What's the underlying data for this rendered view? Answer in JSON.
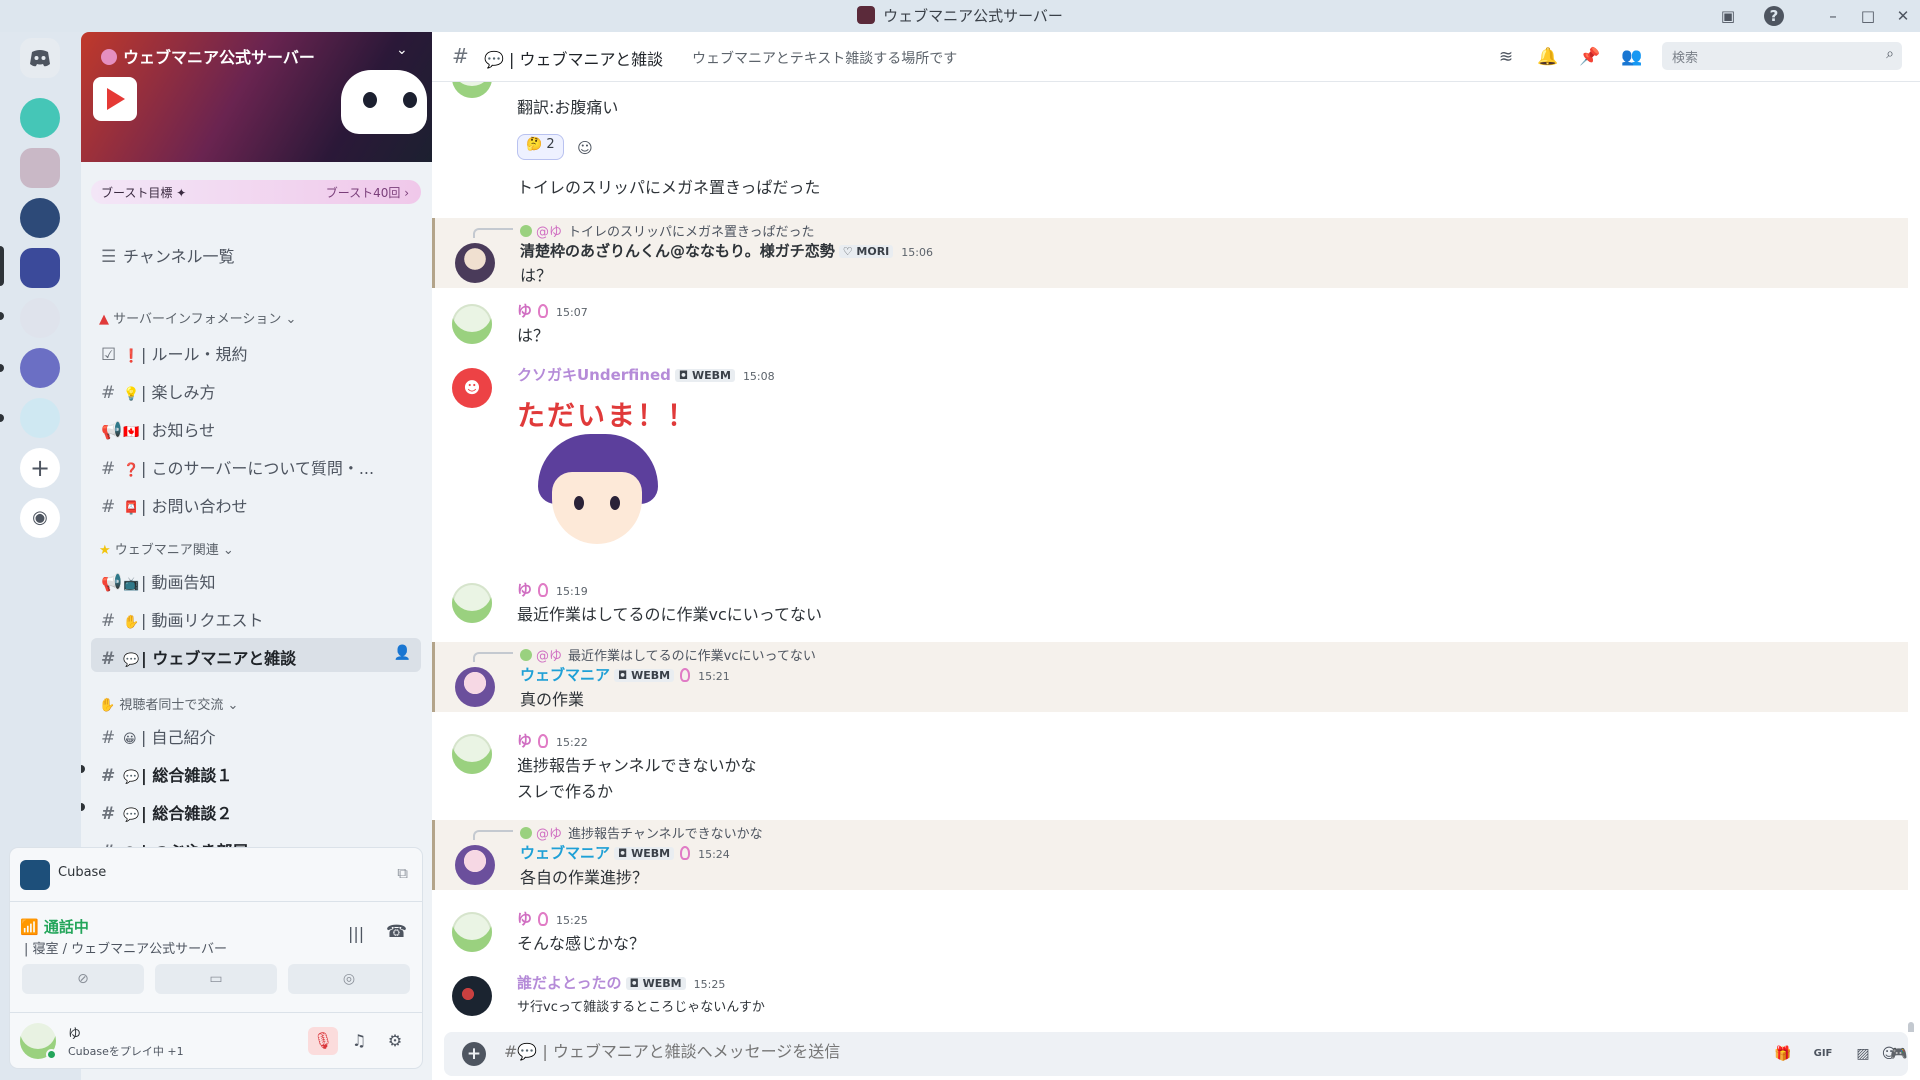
{
  "window": {
    "title": "ウェブマニア公式サーバー"
  },
  "server": {
    "name": "ウェブマニア公式サーバー",
    "boost_label": "ブースト目標",
    "boost_right": "ブースト40回 ›"
  },
  "sidebar": {
    "channel_list_label": "チャンネル一覧",
    "categories": [
      {
        "label": "サーバーインフォメーション ⌄"
      },
      {
        "label": "ウェブマニア関連 ⌄"
      },
      {
        "label": "視聴者同士で交流 ⌄"
      }
    ],
    "channels": [
      {
        "icon": "☑",
        "emo": "❗",
        "label": "| ルール・規約"
      },
      {
        "icon": "#",
        "emo": "💡",
        "label": "| 楽しみ方"
      },
      {
        "icon": "📢",
        "emo": "🇨🇦",
        "label": "| お知らせ"
      },
      {
        "icon": "#",
        "emo": "❓",
        "label": "| このサーバーについて質問・..."
      },
      {
        "icon": "#",
        "emo": "📮",
        "label": "| お問い合わせ"
      },
      {
        "icon": "📢",
        "emo": "📺",
        "label": "| 動画告知"
      },
      {
        "icon": "#",
        "emo": "✋",
        "label": "| 動画リクエスト"
      },
      {
        "icon": "#",
        "emo": "💬",
        "label": "| ウェブマニアと雑談"
      },
      {
        "icon": "#",
        "emo": "😀",
        "label": "| 自己紹介"
      },
      {
        "icon": "#",
        "emo": "💬",
        "label": "| 総合雑談１"
      },
      {
        "icon": "#",
        "emo": "💬",
        "label": "| 総合雑談２"
      },
      {
        "icon": "#",
        "emo": "😊",
        "label": "| つぶやき部屋"
      }
    ]
  },
  "activity": {
    "app": "Cubase"
  },
  "voice": {
    "status": "通話中",
    "location": "| 寝室 / ウェブマニア公式サーバー"
  },
  "user": {
    "name": "ゆ",
    "status": "Cubaseをプレイ中 +1"
  },
  "header": {
    "channel_name": "| ウェブマニアと雑談",
    "topic": "ウェブマニアとテキスト雑談する場所です",
    "search_placeholder": "検索"
  },
  "messages": [
    {
      "text": "翻訳:お腹痛い",
      "reaction_count": "2"
    },
    {
      "text": "トイレのスリッパにメガネ置きっぱだった"
    },
    {
      "reply_who": "@ゆ",
      "reply_text": "トイレのスリッパにメガネ置きっぱだった",
      "author": "清楚枠のあざりんくん@ななもり。様ガチ恋勢",
      "tag": "MORI",
      "time": "15:06",
      "text": "は？"
    },
    {
      "author": "ゆ",
      "time": "15:07",
      "text": "は？"
    },
    {
      "author": "クソガキUnderfined",
      "tag": "WEBM",
      "time": "15:08",
      "sticker_text": "ただいま！！"
    },
    {
      "author": "ゆ",
      "time": "15:19",
      "text": "最近作業はしてるのに作業vcにいってない"
    },
    {
      "reply_who": "@ゆ",
      "reply_text": "最近作業はしてるのに作業vcにいってない",
      "author": "ウェブマニア",
      "tag": "WEBM",
      "time": "15:21",
      "text": "真の作業"
    },
    {
      "author": "ゆ",
      "time": "15:22",
      "text": "進捗報告チャンネルできないかな",
      "text2": "スレで作るか"
    },
    {
      "reply_who": "@ゆ",
      "reply_text": "進捗報告チャンネルできないかな",
      "author": "ウェブマニア",
      "tag": "WEBM",
      "time": "15:24",
      "text": "各自の作業進捗？"
    },
    {
      "author": "ゆ",
      "time": "15:25",
      "text": "そんな感じかな？"
    },
    {
      "author": "誰だよとったの",
      "tag": "WEBM",
      "time": "15:25",
      "text": "サ行vcって雑談するところじゃないんすか"
    }
  ],
  "composer": {
    "placeholder": "#💬 | ウェブマニアと雑談へメッセージを送信"
  },
  "colors": {
    "accent": "#5865f2",
    "online": "#23a55a",
    "webm_name": "#1fa0d6",
    "yu_name": "#d06fc2"
  }
}
